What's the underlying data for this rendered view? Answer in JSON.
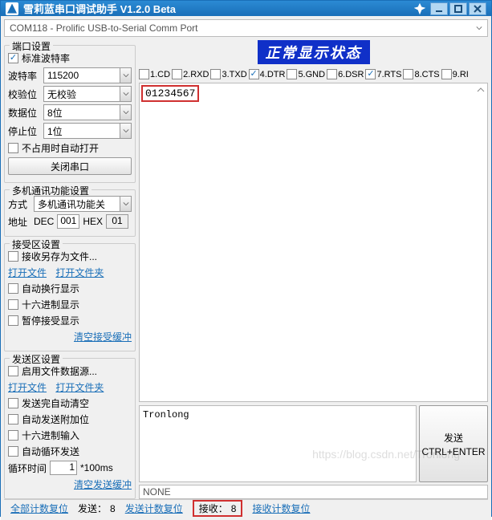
{
  "title": "雪莉蓝串口调试助手  V1.2.0 Beta",
  "port_selected": "COM118 - Prolific USB-to-Serial Comm Port",
  "status_banner": "正常显示状态",
  "signals": [
    {
      "label": "1.CD",
      "checked": false
    },
    {
      "label": "2.RXD",
      "checked": false
    },
    {
      "label": "3.TXD",
      "checked": false
    },
    {
      "label": "4.DTR",
      "checked": true
    },
    {
      "label": "5.GND",
      "checked": false
    },
    {
      "label": "6.DSR",
      "checked": false
    },
    {
      "label": "7.RTS",
      "checked": true
    },
    {
      "label": "8.CTS",
      "checked": false
    },
    {
      "label": "9.RI",
      "checked": false
    }
  ],
  "recv_text": "01234567",
  "send_text": "Tronlong",
  "none_label": "NONE",
  "send_btn_line1": "发送",
  "send_btn_line2": "CTRL+ENTER",
  "port_group": {
    "title": "端口设置",
    "std_baud_label": "标准波特率",
    "std_baud_checked": true,
    "baud_label": "波特率",
    "baud_value": "115200",
    "parity_label": "校验位",
    "parity_value": "无校验",
    "databits_label": "数据位",
    "databits_value": "8位",
    "stopbits_label": "停止位",
    "stopbits_value": "1位",
    "auto_open_label": "不占用时自动打开",
    "auto_open_checked": false,
    "close_btn": "关闭串口"
  },
  "multi_group": {
    "title": "多机通讯功能设置",
    "mode_label": "方式",
    "mode_value": "多机通讯功能关",
    "addr_label": "地址",
    "dec_label": "DEC",
    "dec_value": "001",
    "hex_label": "HEX",
    "hex_value": "01"
  },
  "recv_group": {
    "title": "接受区设置",
    "save_as_label": "接收另存为文件...",
    "save_as_checked": false,
    "open_file": "打开文件",
    "open_folder": "打开文件夹",
    "wrap_label": "自动换行显示",
    "wrap_checked": false,
    "hex_label": "十六进制显示",
    "hex_checked": false,
    "pause_label": "暂停接受显示",
    "pause_checked": false,
    "clear_link": "清空接受缓冲"
  },
  "send_group": {
    "title": "发送区设置",
    "file_src_label": "启用文件数据源...",
    "file_src_checked": false,
    "open_file": "打开文件",
    "open_folder": "打开文件夹",
    "auto_clear_label": "发送完自动清空",
    "auto_clear_checked": false,
    "append_label": "自动发送附加位",
    "append_checked": false,
    "hex_in_label": "十六进制输入",
    "hex_in_checked": false,
    "loop_send_label": "自动循环发送",
    "loop_send_checked": false,
    "loop_time_label": "循环时间",
    "loop_value": "1",
    "loop_unit": "*100ms",
    "clear_link": "清空发送缓冲"
  },
  "status": {
    "reset_all": "全部计数复位",
    "sent_label": "发送：",
    "sent_value": "8",
    "sent_reset": "发送计数复位",
    "recv_label": "接收：",
    "recv_value": "8",
    "recv_reset": "接收计数复位"
  },
  "watermark": "https://blog.csdn.net/Tronlong"
}
